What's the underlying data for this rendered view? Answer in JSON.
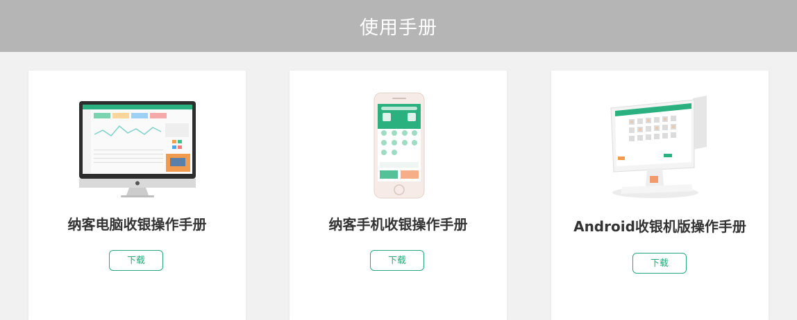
{
  "header": {
    "title": "使用手册"
  },
  "cards": [
    {
      "title": "纳客电脑收银操作手册",
      "button": "下载",
      "device_icon": "imac-icon"
    },
    {
      "title": "纳客手机收银操作手册",
      "button": "下载",
      "device_icon": "smartphone-icon"
    },
    {
      "title": "Android收银机版操作手册",
      "button": "下载",
      "device_icon": "pos-terminal-icon"
    }
  ],
  "colors": {
    "header_bg": "#b5b5b5",
    "page_bg": "#f1f1f1",
    "accent": "#27a878"
  }
}
